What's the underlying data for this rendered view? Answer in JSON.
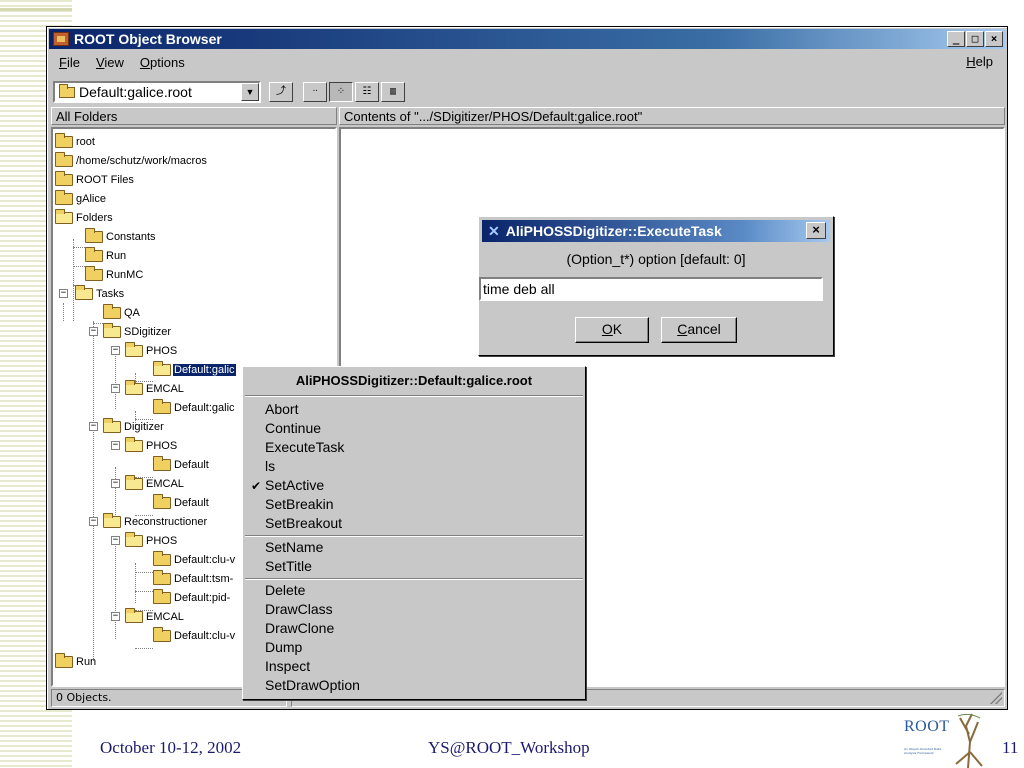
{
  "window": {
    "title": "ROOT Object Browser",
    "menus": [
      {
        "label": "File",
        "key": "F",
        "rest": "ile"
      },
      {
        "label": "View",
        "key": "V",
        "rest": "iew"
      },
      {
        "label": "Options",
        "key": "O",
        "rest": "ptions"
      }
    ],
    "help": {
      "key": "H",
      "rest": "elp"
    },
    "buttons": {
      "minimize": "_",
      "maximize": "□",
      "close": "×"
    }
  },
  "toolbar": {
    "combo_value": "Default:galice.root",
    "combo_arrow": "▼",
    "btn_up": "⤴",
    "btn_large": "ᐧᐧ",
    "btn_small": "⁘",
    "btn_list": "☷",
    "btn_details": "▥"
  },
  "panes": {
    "left_header": "All Folders",
    "right_header": "Contents of \".../SDigitizer/PHOS/Default:galice.root\""
  },
  "tree": {
    "root": "root",
    "macros": "/home/schutz/work/macros",
    "root_files": "ROOT Files",
    "galice": "gAlice",
    "folders": "Folders",
    "constants": "Constants",
    "run": "Run",
    "runmc": "RunMC",
    "tasks": "Tasks",
    "qa": "QA",
    "sdigitizer": "SDigitizer",
    "phos": "PHOS",
    "default_galice_sel": "Default:galic",
    "emcal": "EMCAL",
    "default_galic": "Default:galic",
    "digitizer": "Digitizer",
    "default": "Default",
    "reconstructioner": "Reconstructioner",
    "default_clu": "Default:clu-v",
    "default_tsm": "Default:tsm-",
    "default_pid": "Default:pid-",
    "default_clu2": "Default:clu-v",
    "run2": "Run"
  },
  "status": {
    "objects": "0 Objects."
  },
  "context_menu": {
    "title": "AliPHOSSDigitizer::Default:galice.root",
    "items": [
      "Abort",
      "Continue",
      "ExecuteTask",
      "ls",
      "SetActive",
      "SetBreakin",
      "SetBreakout"
    ],
    "items2": [
      "SetName",
      "SetTitle"
    ],
    "items3": [
      "Delete",
      "DrawClass",
      "DrawClone",
      "Dump",
      "Inspect",
      "SetDrawOption"
    ],
    "check": "✔"
  },
  "dialog": {
    "title": "AliPHOSSDigitizer::ExecuteTask",
    "close": "×",
    "prompt": "(Option_t*)  option  [default: 0]",
    "input_value": "time deb all",
    "ok": {
      "key": "O",
      "rest": "K"
    },
    "cancel": {
      "key": "C",
      "rest": "ancel"
    }
  },
  "slide": {
    "date": "October 10-12, 2002",
    "event": "YS@ROOT_Workshop",
    "page": "11",
    "logo_word": "ROOT",
    "logo_small": "An Object-Oriented Data Analysis Framework"
  }
}
